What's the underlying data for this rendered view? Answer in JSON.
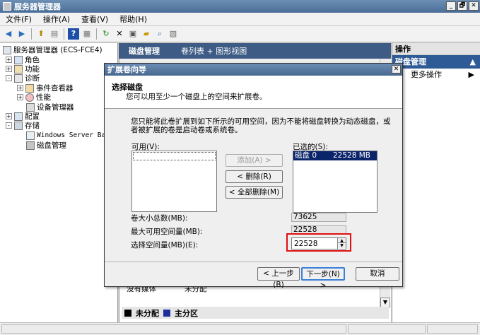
{
  "window": {
    "title": "服务器管理器",
    "controls": [
      "_",
      "🗗",
      "✕"
    ]
  },
  "menu": [
    "文件(F)",
    "操作(A)",
    "查看(V)",
    "帮助(H)"
  ],
  "tree": {
    "root": "服务器管理器 (ECS-FCE4)",
    "items": [
      {
        "label": "角色",
        "level": 1,
        "expander": "+"
      },
      {
        "label": "功能",
        "level": 1,
        "expander": "+"
      },
      {
        "label": "诊断",
        "level": 1,
        "expander": "-"
      },
      {
        "label": "事件查看器",
        "level": 2,
        "expander": "+"
      },
      {
        "label": "性能",
        "level": 2,
        "expander": "+"
      },
      {
        "label": "设备管理器",
        "level": 2,
        "expander": ""
      },
      {
        "label": "配置",
        "level": 1,
        "expander": "+"
      },
      {
        "label": "存储",
        "level": 1,
        "expander": "-"
      },
      {
        "label": "Windows Server Bac",
        "level": 2,
        "expander": ""
      },
      {
        "label": "磁盘管理",
        "level": 2,
        "expander": ""
      }
    ]
  },
  "main": {
    "title": "磁盘管理",
    "view": "卷列表 + 图形视图",
    "lowrow": [
      "没有媒体",
      "未分配"
    ],
    "legend": [
      {
        "label": "未分配",
        "color": "#000000"
      },
      {
        "label": "主分区",
        "color": "#1f2f9a"
      }
    ]
  },
  "actions": {
    "title": "操作",
    "section": "磁盘管理",
    "section_caret": "▲",
    "item": "更多操作",
    "item_caret": "▶"
  },
  "dialog": {
    "title": "扩展卷向导",
    "close": "✕",
    "heading": "选择磁盘",
    "subheading": "您可以用至少一个磁盘上的空间来扩展卷。",
    "description": "您只能将此卷扩展到如下所示的可用空间，因为不能将磁盘转换为动态磁盘，或者被扩展的卷是启动卷或系统卷。",
    "available_label": "可用(V):",
    "selected_label": "已选的(S):",
    "selected_items": [
      {
        "disk": "磁盘 0",
        "size": "22528 MB"
      }
    ],
    "buttons": {
      "add": "添加(A) >",
      "remove": "< 删除(R)",
      "remove_all": "< 全部删除(M)",
      "back": "< 上一步(B)",
      "next": "下一步(N) >",
      "cancel": "取消"
    },
    "total_label": "卷大小总数(MB):",
    "total_value": "73625",
    "max_label": "最大可用空间量(MB):",
    "max_value": "22528",
    "select_label": "选择空间量(MB)(E):",
    "select_value": "22528"
  }
}
